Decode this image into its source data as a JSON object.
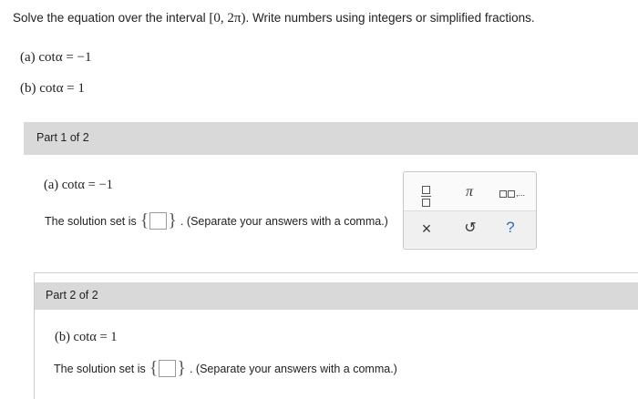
{
  "instructions": {
    "before": "Solve the equation over the interval ",
    "interval": "[0, 2π)",
    "after": ". Write numbers using integers or simplified fractions."
  },
  "problems": {
    "a": "(a)  cotα = −1",
    "b": "(b)  cotα = 1"
  },
  "part1": {
    "header": "Part 1 of 2",
    "equation": "(a)  cotα = −1",
    "answer_prefix": "The solution set is",
    "answer_value": "",
    "answer_suffix": ". (Separate your answers with a comma.)"
  },
  "part2": {
    "header": "Part 2 of 2",
    "equation": "(b)  cotα = 1",
    "answer_prefix": "The solution set is",
    "answer_value": "",
    "answer_suffix": ". (Separate your answers with a comma.)"
  },
  "keypad": {
    "pi": "π",
    "list_suffix": ",...",
    "clear": "×",
    "undo": "↺",
    "help": "?"
  },
  "icons": {
    "fraction": "fraction-icon",
    "pi": "pi-icon",
    "list": "list-icon",
    "clear": "clear-icon",
    "undo": "undo-icon",
    "help": "help-icon"
  }
}
